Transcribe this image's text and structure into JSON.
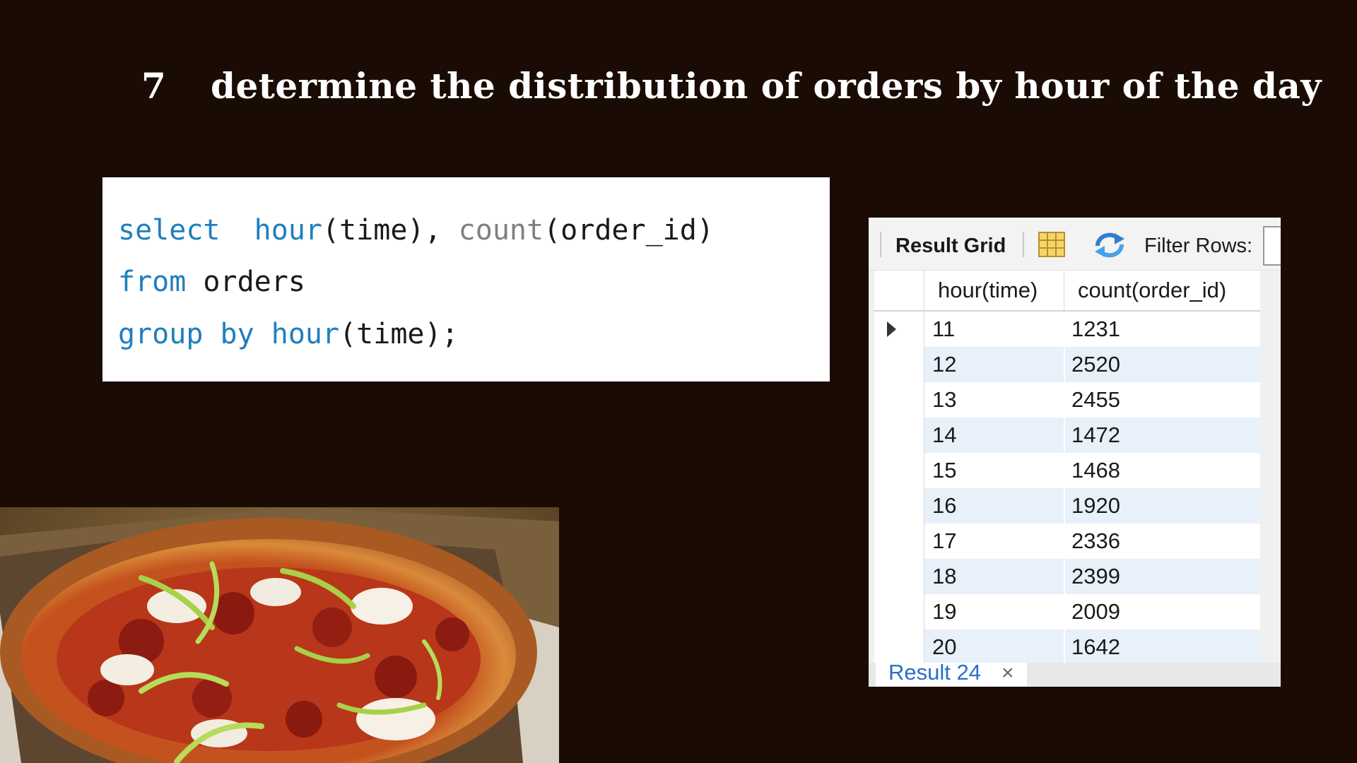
{
  "slide": {
    "number": "7",
    "title": "determine the distribution of orders by hour of the day"
  },
  "sql": {
    "line1": {
      "select": "select",
      "hour": "hour",
      "time_a": "(time),",
      "count": "count",
      "order": "(order_id)"
    },
    "line2": {
      "from": "from",
      "orders": "orders"
    },
    "line3": {
      "group_by": "group by",
      "hour": "hour",
      "time": "(time);"
    }
  },
  "result_grid": {
    "toolbar": {
      "result_grid_label": "Result Grid",
      "filter_rows_label": "Filter Rows:"
    },
    "columns": [
      "hour(time)",
      "count(order_id)"
    ],
    "rows": [
      [
        "11",
        "1231"
      ],
      [
        "12",
        "2520"
      ],
      [
        "13",
        "2455"
      ],
      [
        "14",
        "1472"
      ],
      [
        "15",
        "1468"
      ],
      [
        "16",
        "1920"
      ],
      [
        "17",
        "2336"
      ],
      [
        "18",
        "2399"
      ],
      [
        "19",
        "2009"
      ],
      [
        "20",
        "1642"
      ]
    ],
    "selected_row": 0,
    "result_tab": {
      "label": "Result 24",
      "close": "×"
    }
  },
  "icons": {
    "toolbar_grid": "grid-view-icon",
    "toolbar_refresh": "refresh-icon",
    "row_pointer": "row-pointer-icon",
    "tab_close": "close-icon",
    "photo": "pizza-photo"
  },
  "colors": {
    "background": "#1a0c05",
    "sql_keyword": "#1f7fbf",
    "row_alt": "#e8f0fa",
    "tab_label": "#2a6fc9"
  }
}
